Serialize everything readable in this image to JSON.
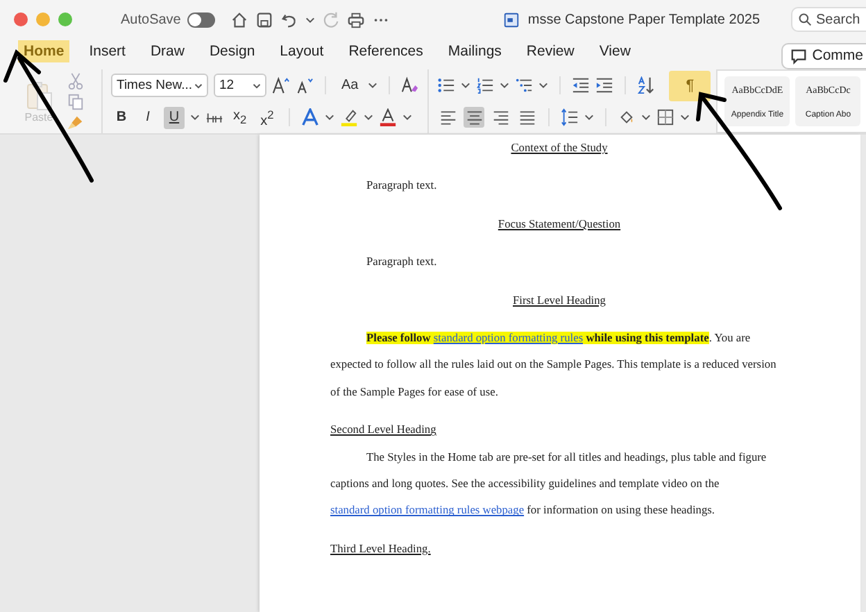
{
  "window": {
    "title": "msse Capstone Paper  Template 2025",
    "autosave_label": "AutoSave",
    "autosave_on": false,
    "search_placeholder": "Search"
  },
  "tabs": [
    {
      "label": "Home",
      "selected": true
    },
    {
      "label": "Insert",
      "selected": false
    },
    {
      "label": "Draw",
      "selected": false
    },
    {
      "label": "Design",
      "selected": false
    },
    {
      "label": "Layout",
      "selected": false
    },
    {
      "label": "References",
      "selected": false
    },
    {
      "label": "Mailings",
      "selected": false
    },
    {
      "label": "Review",
      "selected": false
    },
    {
      "label": "View",
      "selected": false
    }
  ],
  "comments_button": "Comme",
  "ribbon": {
    "paste_label": "Paste",
    "font_name": "Times New...",
    "font_size": "12",
    "case_button": "Aa",
    "format_buttons": [
      {
        "label": "B",
        "kind": "bold",
        "selected": false
      },
      {
        "label": "I",
        "kind": "italic",
        "selected": false
      },
      {
        "label": "U",
        "kind": "underline",
        "selected": true
      }
    ],
    "script_buttons": [
      "x$_{2}$",
      "x$^{2}$"
    ],
    "alignments": [
      {
        "kind": "left",
        "selected": false
      },
      {
        "kind": "center",
        "selected": true
      },
      {
        "kind": "right",
        "selected": false
      },
      {
        "kind": "justify",
        "selected": false
      }
    ],
    "show_marks_button": {
      "label": "¶",
      "highlighted": true
    },
    "styles": [
      {
        "preview": "AaBbCcDdE",
        "name": "Appendix Title"
      },
      {
        "preview": "AaBbCcDc",
        "name": "Caption Abo"
      }
    ]
  },
  "document": {
    "blocks": [
      {
        "kind": "centered_heading",
        "text": "Context of the Study"
      },
      {
        "kind": "body",
        "segments": [
          {
            "text": "Paragraph text.",
            "highlighted": false,
            "link": false
          }
        ]
      },
      {
        "kind": "centered_heading",
        "text": "Focus Statement/Question"
      },
      {
        "kind": "body",
        "segments": [
          {
            "text": "Paragraph text.",
            "highlighted": false,
            "link": false
          }
        ]
      },
      {
        "kind": "centered_heading",
        "text": "First Level Heading"
      },
      {
        "kind": "body",
        "segments": [
          {
            "text": "Please follow ",
            "highlighted": true,
            "link": false
          },
          {
            "text": "standard option formatting rules",
            "highlighted": true,
            "link": true
          },
          {
            "text": " while using this template",
            "highlighted": true,
            "link": false
          },
          {
            "text": ". You are expected to follow all the rules laid out on the Sample Pages. This template is a reduced version of the Sample Pages for ease of use.",
            "highlighted": false,
            "link": false
          }
        ]
      },
      {
        "kind": "side_heading",
        "text": "Second Level Heading"
      },
      {
        "kind": "body",
        "segments": [
          {
            "text": "The Styles in the Home tab are pre-set for all titles and headings, plus table and figure captions and long quotes. See the accessibility guidelines and template video on the ",
            "highlighted": false,
            "link": false
          },
          {
            "text": "standard option formatting rules webpage",
            "highlighted": false,
            "link": true
          },
          {
            "text": " for information on using these headings.",
            "highlighted": false,
            "link": false
          }
        ]
      },
      {
        "kind": "side_heading",
        "text": "Third Level Heading."
      }
    ]
  }
}
